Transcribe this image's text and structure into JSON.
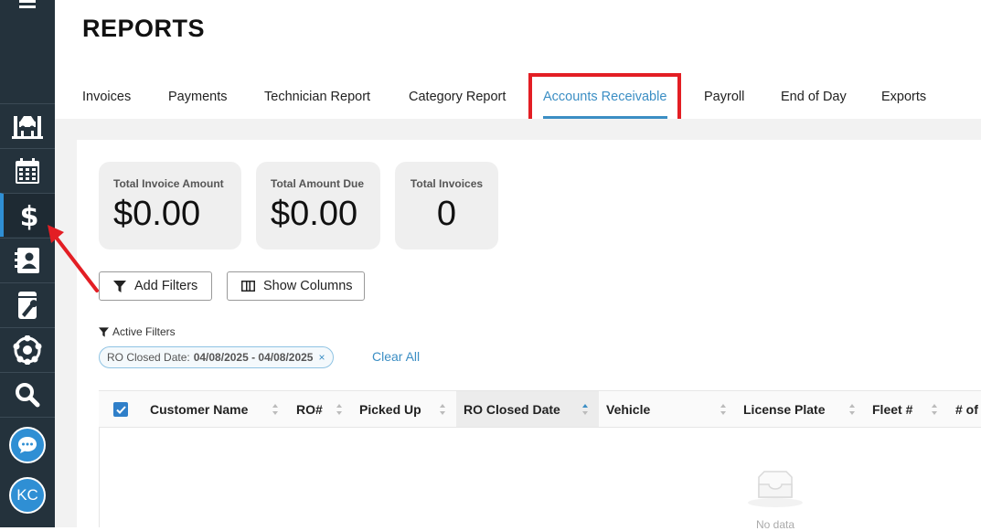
{
  "sidebar": {
    "menu_icon": "hamburger-menu-icon",
    "items": [
      {
        "name": "service-lift-icon",
        "active": false
      },
      {
        "name": "calendar-icon",
        "active": false
      },
      {
        "name": "dollar-icon",
        "active": true
      },
      {
        "name": "contacts-icon",
        "active": false
      },
      {
        "name": "parts-wrench-icon",
        "active": false
      },
      {
        "name": "integrations-icon",
        "active": false
      },
      {
        "name": "search-icon",
        "active": false
      }
    ],
    "chat_icon": "chat-bubble-icon",
    "avatar": "KC",
    "accent": "#2f8fd4"
  },
  "header": {
    "title": "REPORTS"
  },
  "tabs": [
    {
      "label": "Invoices"
    },
    {
      "label": "Payments"
    },
    {
      "label": "Technician Report"
    },
    {
      "label": "Category Report"
    },
    {
      "label": "Accounts Receivable",
      "active": true
    },
    {
      "label": "Payroll"
    },
    {
      "label": "End of Day"
    },
    {
      "label": "Exports"
    }
  ],
  "stats": [
    {
      "label": "Total Invoice Amount",
      "value": "$0.00"
    },
    {
      "label": "Total Amount Due",
      "value": "$0.00"
    },
    {
      "label": "Total Invoices",
      "value": "0"
    }
  ],
  "toolbar": {
    "add_filters": "Add Filters",
    "show_columns": "Show Columns"
  },
  "filters": {
    "title": "Active Filters",
    "chip_label": "RO Closed Date:",
    "chip_value": "04/08/2025 - 04/08/2025",
    "chip_remove": "×",
    "clear_all": "Clear All"
  },
  "table": {
    "columns": [
      "Customer Name",
      "RO#",
      "Picked Up",
      "RO Closed Date",
      "Vehicle",
      "License Plate",
      "Fleet #",
      "# of"
    ],
    "sorted_column": "RO Closed Date",
    "empty_text": "No data"
  },
  "annotation": {
    "color": "#e31e24"
  }
}
